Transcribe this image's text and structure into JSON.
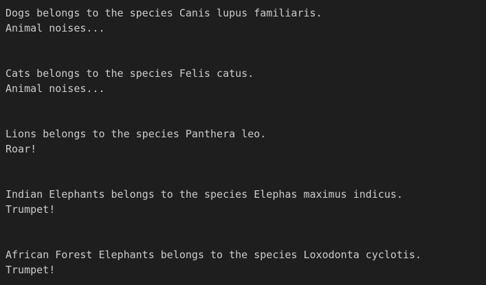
{
  "colors": {
    "background": "#1e1e1e",
    "text": "#cccccc"
  },
  "output": [
    {
      "description": "Dogs belongs to the species Canis lupus familiaris.",
      "sound": "Animal noises..."
    },
    {
      "description": "Cats belongs to the species Felis catus.",
      "sound": "Animal noises..."
    },
    {
      "description": "Lions belongs to the species Panthera leo.",
      "sound": "Roar!"
    },
    {
      "description": "Indian Elephants belongs to the species Elephas maximus indicus.",
      "sound": "Trumpet!"
    },
    {
      "description": "African Forest Elephants belongs to the species Loxodonta cyclotis.",
      "sound": "Trumpet!"
    }
  ]
}
